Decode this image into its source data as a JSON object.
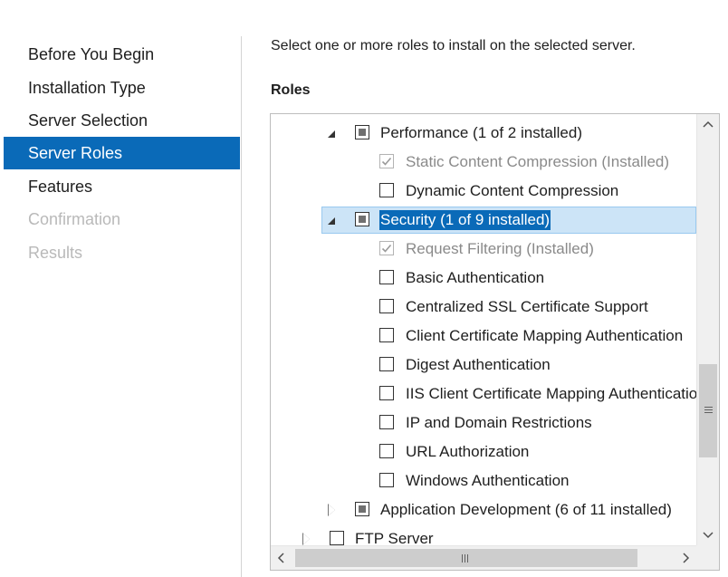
{
  "nav": {
    "items": [
      {
        "label": "Before You Begin",
        "state": "normal"
      },
      {
        "label": "Installation Type",
        "state": "normal"
      },
      {
        "label": "Server Selection",
        "state": "normal"
      },
      {
        "label": "Server Roles",
        "state": "active"
      },
      {
        "label": "Features",
        "state": "normal"
      },
      {
        "label": "Confirmation",
        "state": "disabled"
      },
      {
        "label": "Results",
        "state": "disabled"
      }
    ]
  },
  "content": {
    "instruction": "Select one or more roles to install on the selected server.",
    "roles_heading": "Roles"
  },
  "tree": {
    "rows": [
      {
        "label": "Performance (1 of 2 installed)",
        "checkbox": "partial",
        "expander": "expanded"
      },
      {
        "label": "Static Content Compression (Installed)",
        "checkbox": "checked-disabled"
      },
      {
        "label": "Dynamic Content Compression",
        "checkbox": "unchecked"
      },
      {
        "label": "Security (1 of 9 installed)",
        "checkbox": "partial",
        "expander": "expanded",
        "selected": true
      },
      {
        "label": "Request Filtering (Installed)",
        "checkbox": "checked-disabled"
      },
      {
        "label": "Basic Authentication",
        "checkbox": "unchecked"
      },
      {
        "label": "Centralized SSL Certificate Support",
        "checkbox": "unchecked"
      },
      {
        "label": "Client Certificate Mapping Authentication",
        "checkbox": "unchecked"
      },
      {
        "label": "Digest Authentication",
        "checkbox": "unchecked"
      },
      {
        "label": "IIS Client Certificate Mapping Authentication",
        "checkbox": "unchecked"
      },
      {
        "label": "IP and Domain Restrictions",
        "checkbox": "unchecked"
      },
      {
        "label": "URL Authorization",
        "checkbox": "unchecked"
      },
      {
        "label": "Windows Authentication",
        "checkbox": "unchecked"
      },
      {
        "label": "Application Development (6 of 11 installed)",
        "checkbox": "partial",
        "expander": "collapsed"
      },
      {
        "label": "FTP Server",
        "checkbox": "unchecked",
        "expander": "collapsed"
      }
    ]
  },
  "scrollbars": {
    "up_icon": "chevron-up-icon",
    "down_icon": "chevron-down-icon",
    "left_icon": "chevron-left-icon",
    "right_icon": "chevron-right-icon"
  },
  "colors": {
    "accent": "#0a6ab8",
    "selection_bg": "#cce4f7",
    "disabled_text": "#b9b9b9"
  }
}
